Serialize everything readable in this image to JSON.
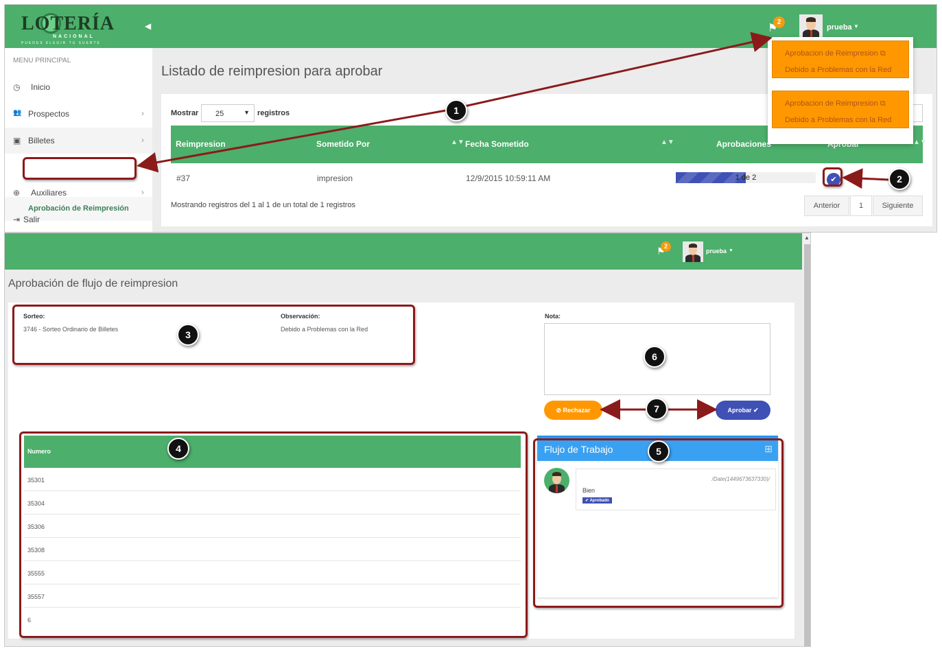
{
  "top": {
    "logo": {
      "word": "LOTERÍA",
      "sub": "NACIONAL",
      "tag": "PUEDES ELEGIR TU SUERTE"
    },
    "notif_count": "2",
    "username": "prueba",
    "sidebar": {
      "title": "MENU PRINCIPAL",
      "items": [
        {
          "label": "Inicio",
          "icon": "◷"
        },
        {
          "label": "Prospectos",
          "icon": "👥"
        },
        {
          "label": "Billetes",
          "icon": "▣"
        },
        {
          "label": "Auxiliares",
          "icon": "⊕"
        },
        {
          "label": "Salir",
          "icon": "⇥"
        }
      ],
      "sub_item": "Aprobación de Reimpresión"
    },
    "page_title": "Listado de reimpresion para aprobar",
    "controls": {
      "mostrar": "Mostrar",
      "page_size": "25",
      "registros": "registros"
    },
    "table": {
      "headers": [
        "Reimpresion",
        "Sometido Por",
        "Fecha Sometido",
        "Aprobaciones",
        "Aprobar"
      ],
      "row": {
        "id": "#37",
        "by": "impresion",
        "date": "12/9/2015 10:59:11 AM",
        "approvals_text": "1 de 2",
        "approvals_done": 1,
        "approvals_total": 2
      }
    },
    "footer_info": "Mostrando registros del 1 al 1 de un total de 1 registros",
    "pager": {
      "prev": "Anterior",
      "page": "1",
      "next": "Siguiente"
    },
    "notifications": [
      {
        "title": "Aprobacion de Reimpresion",
        "subtitle": "Debido a Problemas con la Red"
      },
      {
        "title": "Aprobacion de Reimpresion",
        "subtitle": "Debido a Problemas con la Red"
      }
    ]
  },
  "bottom": {
    "notif_count": "2",
    "username": "prueba",
    "page_title": "Aprobación de flujo de reimpresion",
    "sorteo_label": "Sorteo:",
    "sorteo_value": "3746 - Sorteo Ordinario de Billetes",
    "obs_label": "Observación:",
    "obs_value": "Debido a Problemas con la Red",
    "nota_label": "Nota:",
    "btn_rechazar": "⊘ Rechazar",
    "btn_aprobar": "Aprobar ✔",
    "numbers_header": "Numero",
    "numbers": [
      "35301",
      "35304",
      "35306",
      "35308",
      "35555",
      "35557",
      "6"
    ],
    "flujo_title": "Flujo de Trabajo",
    "flujo_entry": {
      "date": "/Date(1449673637330)/",
      "text": "Bien",
      "status": "✔ Aprobado"
    }
  },
  "callouts": [
    "1",
    "2",
    "3",
    "4",
    "5",
    "6",
    "7"
  ],
  "colors": {
    "green": "#4caf6b",
    "orange": "#ff9800",
    "indigo": "#3f51b5",
    "annotation": "#8b1a1a"
  }
}
